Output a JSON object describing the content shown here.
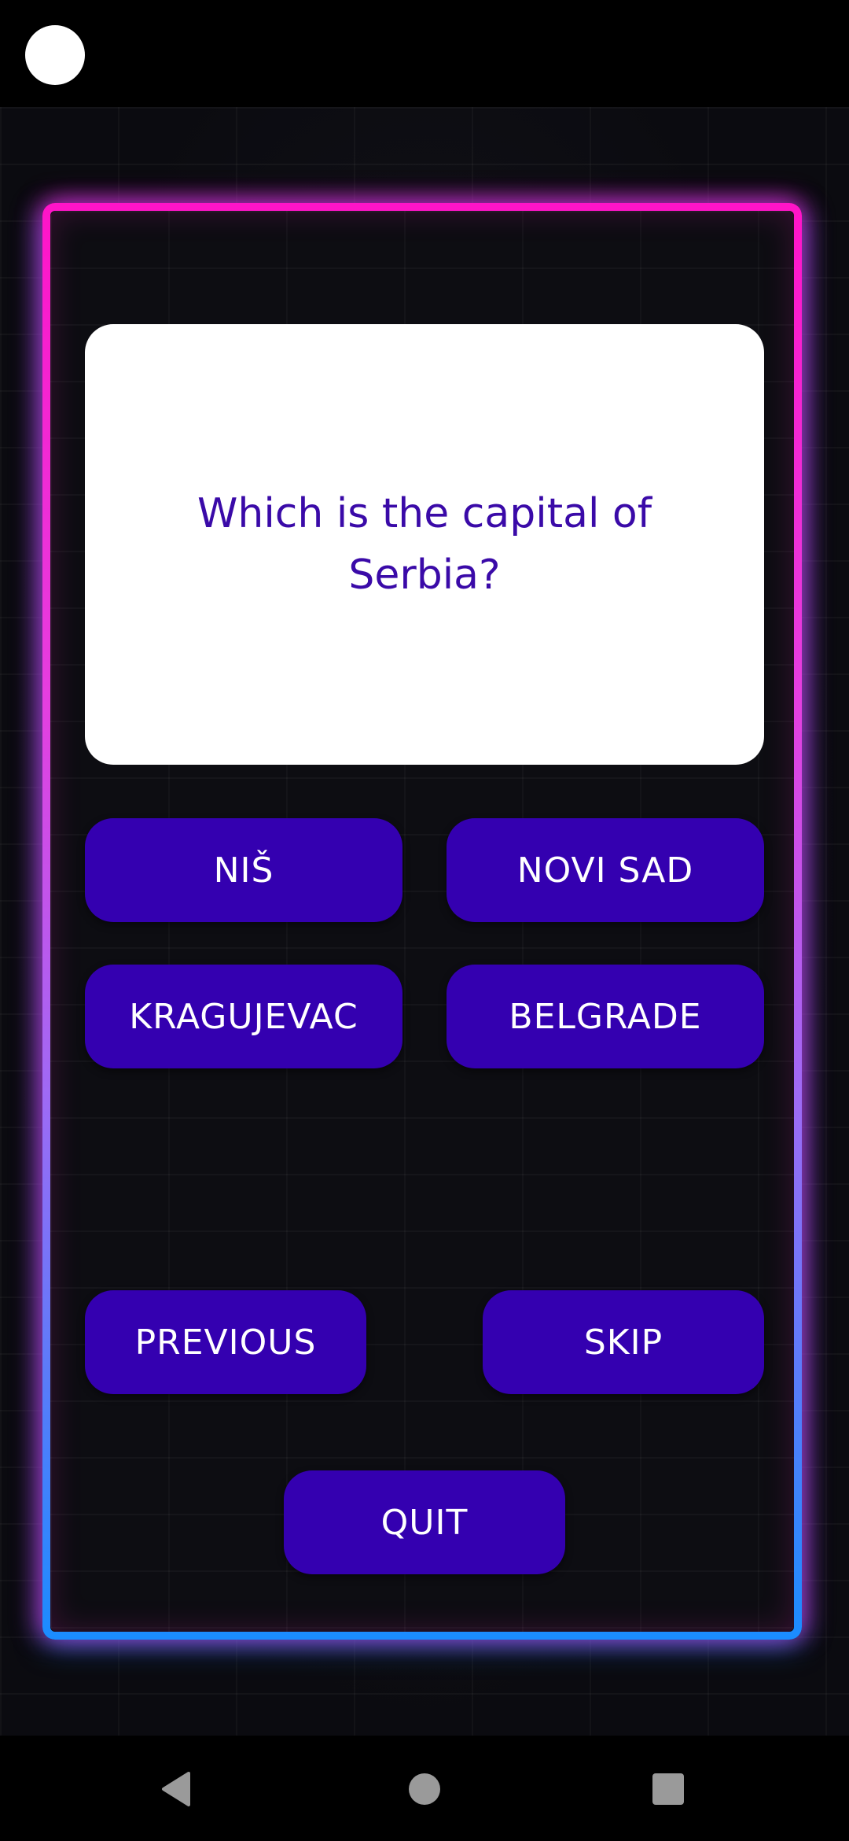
{
  "question": {
    "text": "Which is the capital of Serbia?"
  },
  "answers": [
    {
      "label": "NIŠ"
    },
    {
      "label": "NOVI SAD"
    },
    {
      "label": "KRAGUJEVAC"
    },
    {
      "label": "BELGRADE"
    }
  ],
  "controls": {
    "previous_label": "PREVIOUS",
    "skip_label": "SKIP",
    "quit_label": "QUIT"
  },
  "icons": {
    "camera": "camera-icon",
    "back": "back-icon",
    "home": "home-icon",
    "recents": "recents-icon"
  },
  "colors": {
    "button": "#3400b0",
    "question_text": "#3a0aa8",
    "neon_top": "#ff14c8",
    "neon_bottom": "#1a8cff",
    "card": "#ffffff"
  }
}
